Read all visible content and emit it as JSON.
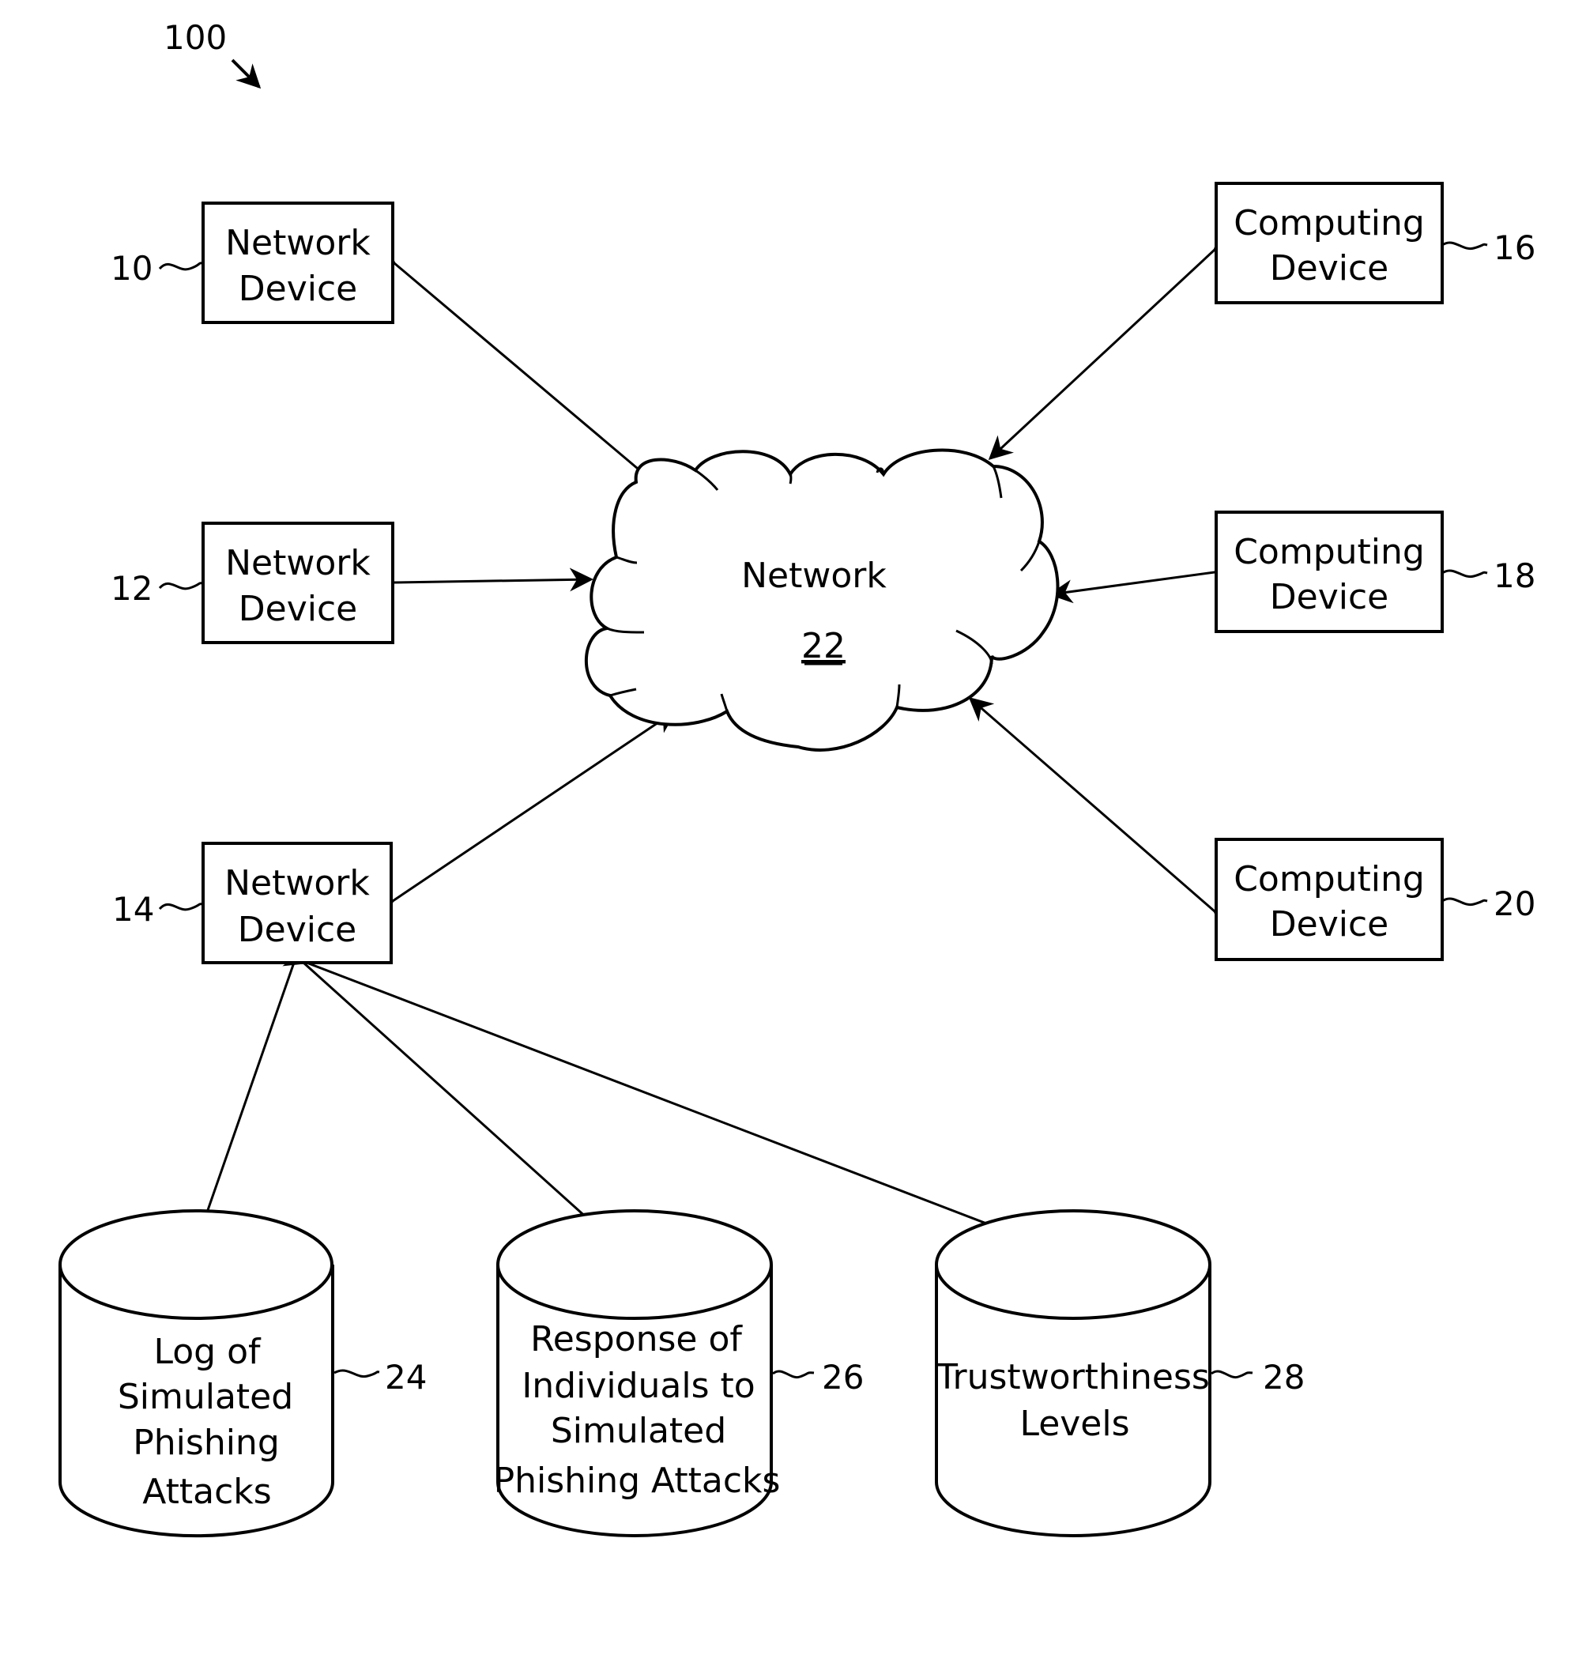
{
  "figure": {
    "reference": "100"
  },
  "network": {
    "label": "Network",
    "ref": "22"
  },
  "network_devices": [
    {
      "label_line1": "Network",
      "label_line2": "Device",
      "ref": "10"
    },
    {
      "label_line1": "Network",
      "label_line2": "Device",
      "ref": "12"
    },
    {
      "label_line1": "Network",
      "label_line2": "Device",
      "ref": "14"
    }
  ],
  "computing_devices": [
    {
      "label_line1": "Computing",
      "label_line2": "Device",
      "ref": "16"
    },
    {
      "label_line1": "Computing",
      "label_line2": "Device",
      "ref": "18"
    },
    {
      "label_line1": "Computing",
      "label_line2": "Device",
      "ref": "20"
    }
  ],
  "databases": [
    {
      "lines": [
        "Log of",
        "Simulated",
        "Phishing",
        "Attacks"
      ],
      "ref": "24"
    },
    {
      "lines": [
        "Response of",
        "Individuals to",
        "Simulated",
        "Phishing Attacks"
      ],
      "ref": "26"
    },
    {
      "lines": [
        "Trustworthiness",
        "Levels"
      ],
      "ref": "28"
    }
  ]
}
